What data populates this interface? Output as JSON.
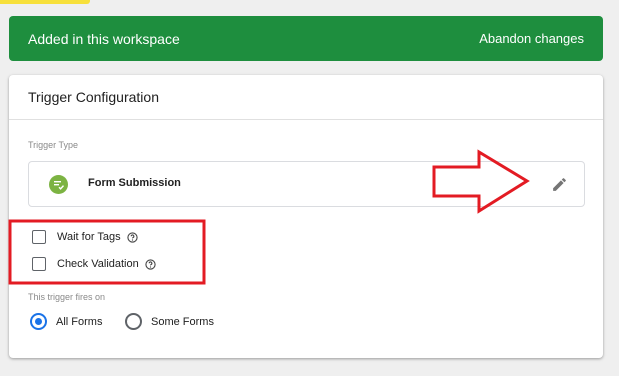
{
  "banner": {
    "title": "Added in this workspace",
    "action": "Abandon changes",
    "color": "#1e8e3e"
  },
  "card": {
    "title": "Trigger Configuration",
    "trigger_type_label": "Trigger Type",
    "trigger_type": {
      "name": "Form Submission",
      "icon": "form-submission-icon",
      "icon_color": "#7cb342",
      "edit_icon": "pencil-icon"
    },
    "options": [
      {
        "label": "Wait for Tags",
        "checked": false,
        "help_icon": "help-icon"
      },
      {
        "label": "Check Validation",
        "checked": false,
        "help_icon": "help-icon"
      }
    ],
    "fires_on_label": "This trigger fires on",
    "fires_on": {
      "options": [
        "All Forms",
        "Some Forms"
      ],
      "selected": "All Forms"
    }
  },
  "annotations": {
    "color": "#e31b23",
    "shapes": [
      "highlight-rectangle",
      "arrow-right"
    ]
  }
}
